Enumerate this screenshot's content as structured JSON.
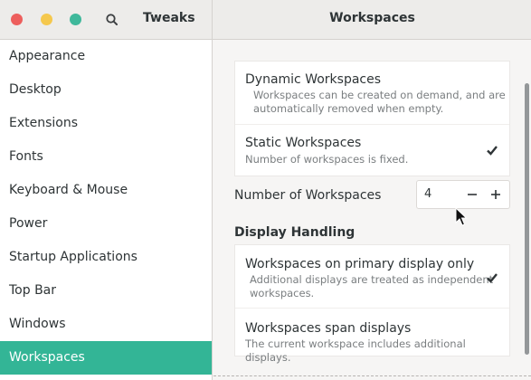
{
  "window": {
    "app_title": "Tweaks",
    "page_title": "Workspaces",
    "controls": [
      "close-icon",
      "minimize-icon",
      "maximize-icon"
    ],
    "colors": {
      "close": "#ed5f5d",
      "minimize": "#f5c84d",
      "maximize": "#3fb89b",
      "accent": "#33b596"
    }
  },
  "sidebar": {
    "items": [
      {
        "label": "Appearance"
      },
      {
        "label": "Desktop"
      },
      {
        "label": "Extensions"
      },
      {
        "label": "Fonts"
      },
      {
        "label": "Keyboard & Mouse"
      },
      {
        "label": "Power"
      },
      {
        "label": "Startup Applications"
      },
      {
        "label": "Top Bar"
      },
      {
        "label": "Windows"
      },
      {
        "label": "Workspaces",
        "active": true
      }
    ]
  },
  "workspaces": {
    "dynamic": {
      "title": "Dynamic Workspaces",
      "subtitle_line1": "Workspaces can be created on demand, and are",
      "subtitle_line2": "automatically removed when empty.",
      "selected": false
    },
    "static": {
      "title": "Static Workspaces",
      "subtitle": "Number of workspaces is fixed.",
      "selected": true
    },
    "number": {
      "label": "Number of Workspaces",
      "value": "4"
    }
  },
  "display_handling": {
    "heading": "Display Handling",
    "primary_only": {
      "title": "Workspaces on primary display only",
      "subtitle_line1": "Additional displays are treated as independent",
      "subtitle_line2": "workspaces.",
      "selected": true
    },
    "span": {
      "title": "Workspaces span displays",
      "subtitle": "The current workspace includes additional displays.",
      "selected": false
    }
  }
}
